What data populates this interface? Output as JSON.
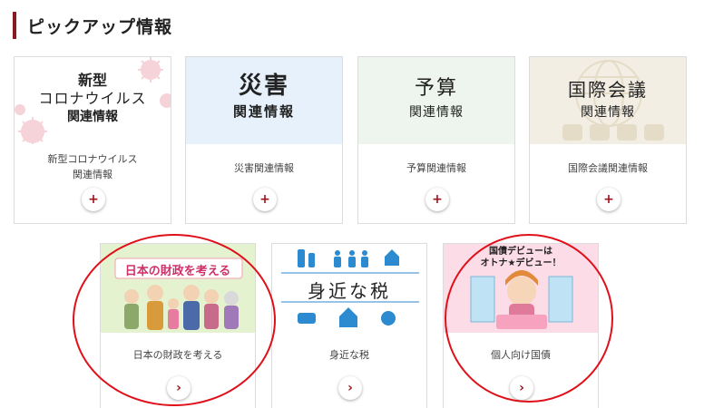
{
  "section": {
    "title": "ピックアップ情報"
  },
  "cards_top": [
    {
      "img_lines": [
        "新型",
        "コロナウイルス",
        "関連情報"
      ],
      "caption": "新型コロナウイルス\n関連情報",
      "button": "+"
    },
    {
      "img_lines": [
        "災害",
        "関連情報"
      ],
      "caption": "災害関連情報",
      "button": "+"
    },
    {
      "img_lines": [
        "予算",
        "関連情報"
      ],
      "caption": "予算関連情報",
      "button": "+"
    },
    {
      "img_lines": [
        "国際会議",
        "関連情報"
      ],
      "caption": "国際会議関連情報",
      "button": "+"
    }
  ],
  "cards_bottom": [
    {
      "banner": "日本の財政を考える",
      "caption": "日本の財政を考える",
      "button": "›"
    },
    {
      "banner": "身近な税",
      "caption": "身近な税",
      "button": "›"
    },
    {
      "banner_lines": [
        "国債デビューは",
        "オトナ★デビュー！"
      ],
      "caption": "個人向け国債",
      "button": "›"
    }
  ],
  "colors": {
    "accent": "#8b1a1a",
    "button_icon": "#a0141e",
    "covid_bg": "#ffffff",
    "disaster_bg": "#e6f1fb",
    "budget_bg": "#eef5ee",
    "conference_bg": "#f2eee3",
    "highlight": "#e0101a"
  }
}
